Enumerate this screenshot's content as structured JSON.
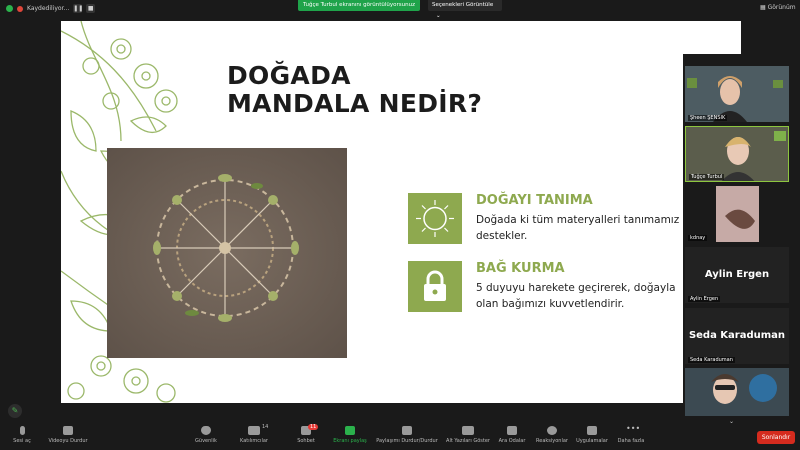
{
  "topbar": {
    "recording_label": "Kaydediliyor...",
    "share_banner": "Tuğçe Turbul ekranını görüntülüyorsunuz",
    "view_options": "Seçenekleri Görüntüle",
    "view_label": "Görünüm"
  },
  "slide": {
    "title_line1": "DOĞADA",
    "title_line2": "MANDALA NEDİR?",
    "cards": [
      {
        "icon": "sun-icon",
        "heading": "DOĞAYI TANIMA",
        "text_line1": "Doğada ki tüm materyalleri tanımamız",
        "text_line2": "destekler."
      },
      {
        "icon": "lock-icon",
        "heading": "BAĞ KURMA",
        "text_line1": "5 duyuyu harekete geçirerek, doğayla",
        "text_line2": "olan bağımızı kuvvetlendirir."
      }
    ],
    "accent_color": "#8ea94f"
  },
  "participants": [
    {
      "name": "Şheen ŞENSIK",
      "type": "video"
    },
    {
      "name": "Tuğçe Turbul",
      "type": "video",
      "active": true
    },
    {
      "name": "kdnay",
      "type": "video"
    },
    {
      "name": "Aylin Ergen",
      "display": "Aylin Ergen",
      "type": "name"
    },
    {
      "name": "Seda Karaduman",
      "display": "Seda Karaduman",
      "type": "name"
    },
    {
      "name": "",
      "type": "video"
    }
  ],
  "toolbar": {
    "items": [
      {
        "label": "Sesi aç",
        "icon": "mic-icon"
      },
      {
        "label": "Videoyu Durdur",
        "icon": "video-icon"
      },
      {
        "label": "Güvenlik",
        "icon": "shield-icon"
      },
      {
        "label": "Katılımcılar",
        "icon": "participants-icon",
        "count": "14"
      },
      {
        "label": "Sohbet",
        "icon": "chat-icon",
        "badge": "11"
      },
      {
        "label": "Ekranı paylaş",
        "icon": "share-screen-icon"
      },
      {
        "label": "Paylaşımı Durdur/Durdur",
        "icon": "pause-share-icon"
      },
      {
        "label": "Alt Yazıları Göster",
        "icon": "cc-icon"
      },
      {
        "label": "Ara Odalar",
        "icon": "breakout-icon"
      },
      {
        "label": "Reaksiyonlar",
        "icon": "reaction-icon"
      },
      {
        "label": "Uygulamalar",
        "icon": "apps-icon"
      },
      {
        "label": "Daha fazla",
        "icon": "more-icon"
      }
    ],
    "end_label": "Sonlandır"
  },
  "colors": {
    "share_green": "#1fa34a",
    "end_red": "#d52b1e",
    "slide_green": "#8ea94f"
  }
}
